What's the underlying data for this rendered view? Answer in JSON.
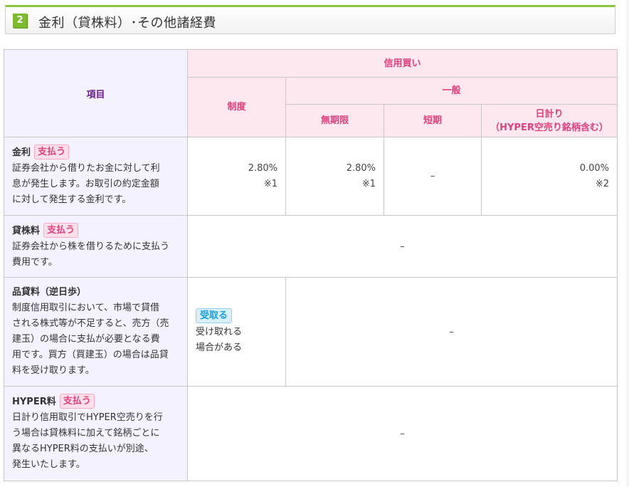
{
  "section": {
    "number": "2",
    "title": "金利（貸株料）･その他諸経費"
  },
  "table": {
    "headers": {
      "item": "項目",
      "margin_buy": "信用買い",
      "seido": "制度",
      "ippan": "一般",
      "mukigen": "無期限",
      "tanki": "短期",
      "hibakari_line1": "日計り",
      "hibakari_line2": "（HYPER空売り銘柄含む）"
    },
    "rows": {
      "kinri": {
        "name": "金利",
        "badge": "支払う",
        "desc_lines": [
          "証券会社から借りたお金に対して利",
          "息が発生します。お取引の約定金額",
          "に対して発生する金利です。"
        ],
        "seido_value": "2.80%",
        "seido_note": "※1",
        "mukigen_value": "2.80%",
        "mukigen_note": "※1",
        "tanki_value": "–",
        "hibakari_value": "0.00%",
        "hibakari_note": "※2"
      },
      "kashikabu": {
        "name": "貸株料",
        "badge": "支払う",
        "desc_lines": [
          "証券会社から株を借りるために支払う",
          "費用です。"
        ],
        "value": "–"
      },
      "hinkashi": {
        "name": "品貸料（逆日歩）",
        "desc_lines": [
          "制度信用取引において、市場で貸借",
          "される株式等が不足すると、売方（売",
          "建玉）の場合に支払が必要となる費",
          "用です。買方（買建玉）の場合は品貸",
          "料を受け取ります。"
        ],
        "seido_badge": "受取る",
        "seido_text_lines": [
          "受け取れる",
          "場合がある"
        ],
        "other_value": "–"
      },
      "hyper": {
        "name": "HYPER料",
        "badge": "支払う",
        "desc_lines": [
          "日計り信用取引でHYPER空売りを行",
          "う場合は貸株料に加えて銘柄ごとに",
          "異なるHYPER料の支払いが別途、",
          "発生いたします。"
        ],
        "value": "–"
      }
    }
  },
  "colors": {
    "accent_green": "#8cc63f",
    "pink_header": "#fde8ef",
    "pink_text": "#e0407c",
    "item_bg": "#f4f2ff",
    "item_head_text": "#6b1e8f",
    "recv_badge": "#1aa0d8"
  }
}
